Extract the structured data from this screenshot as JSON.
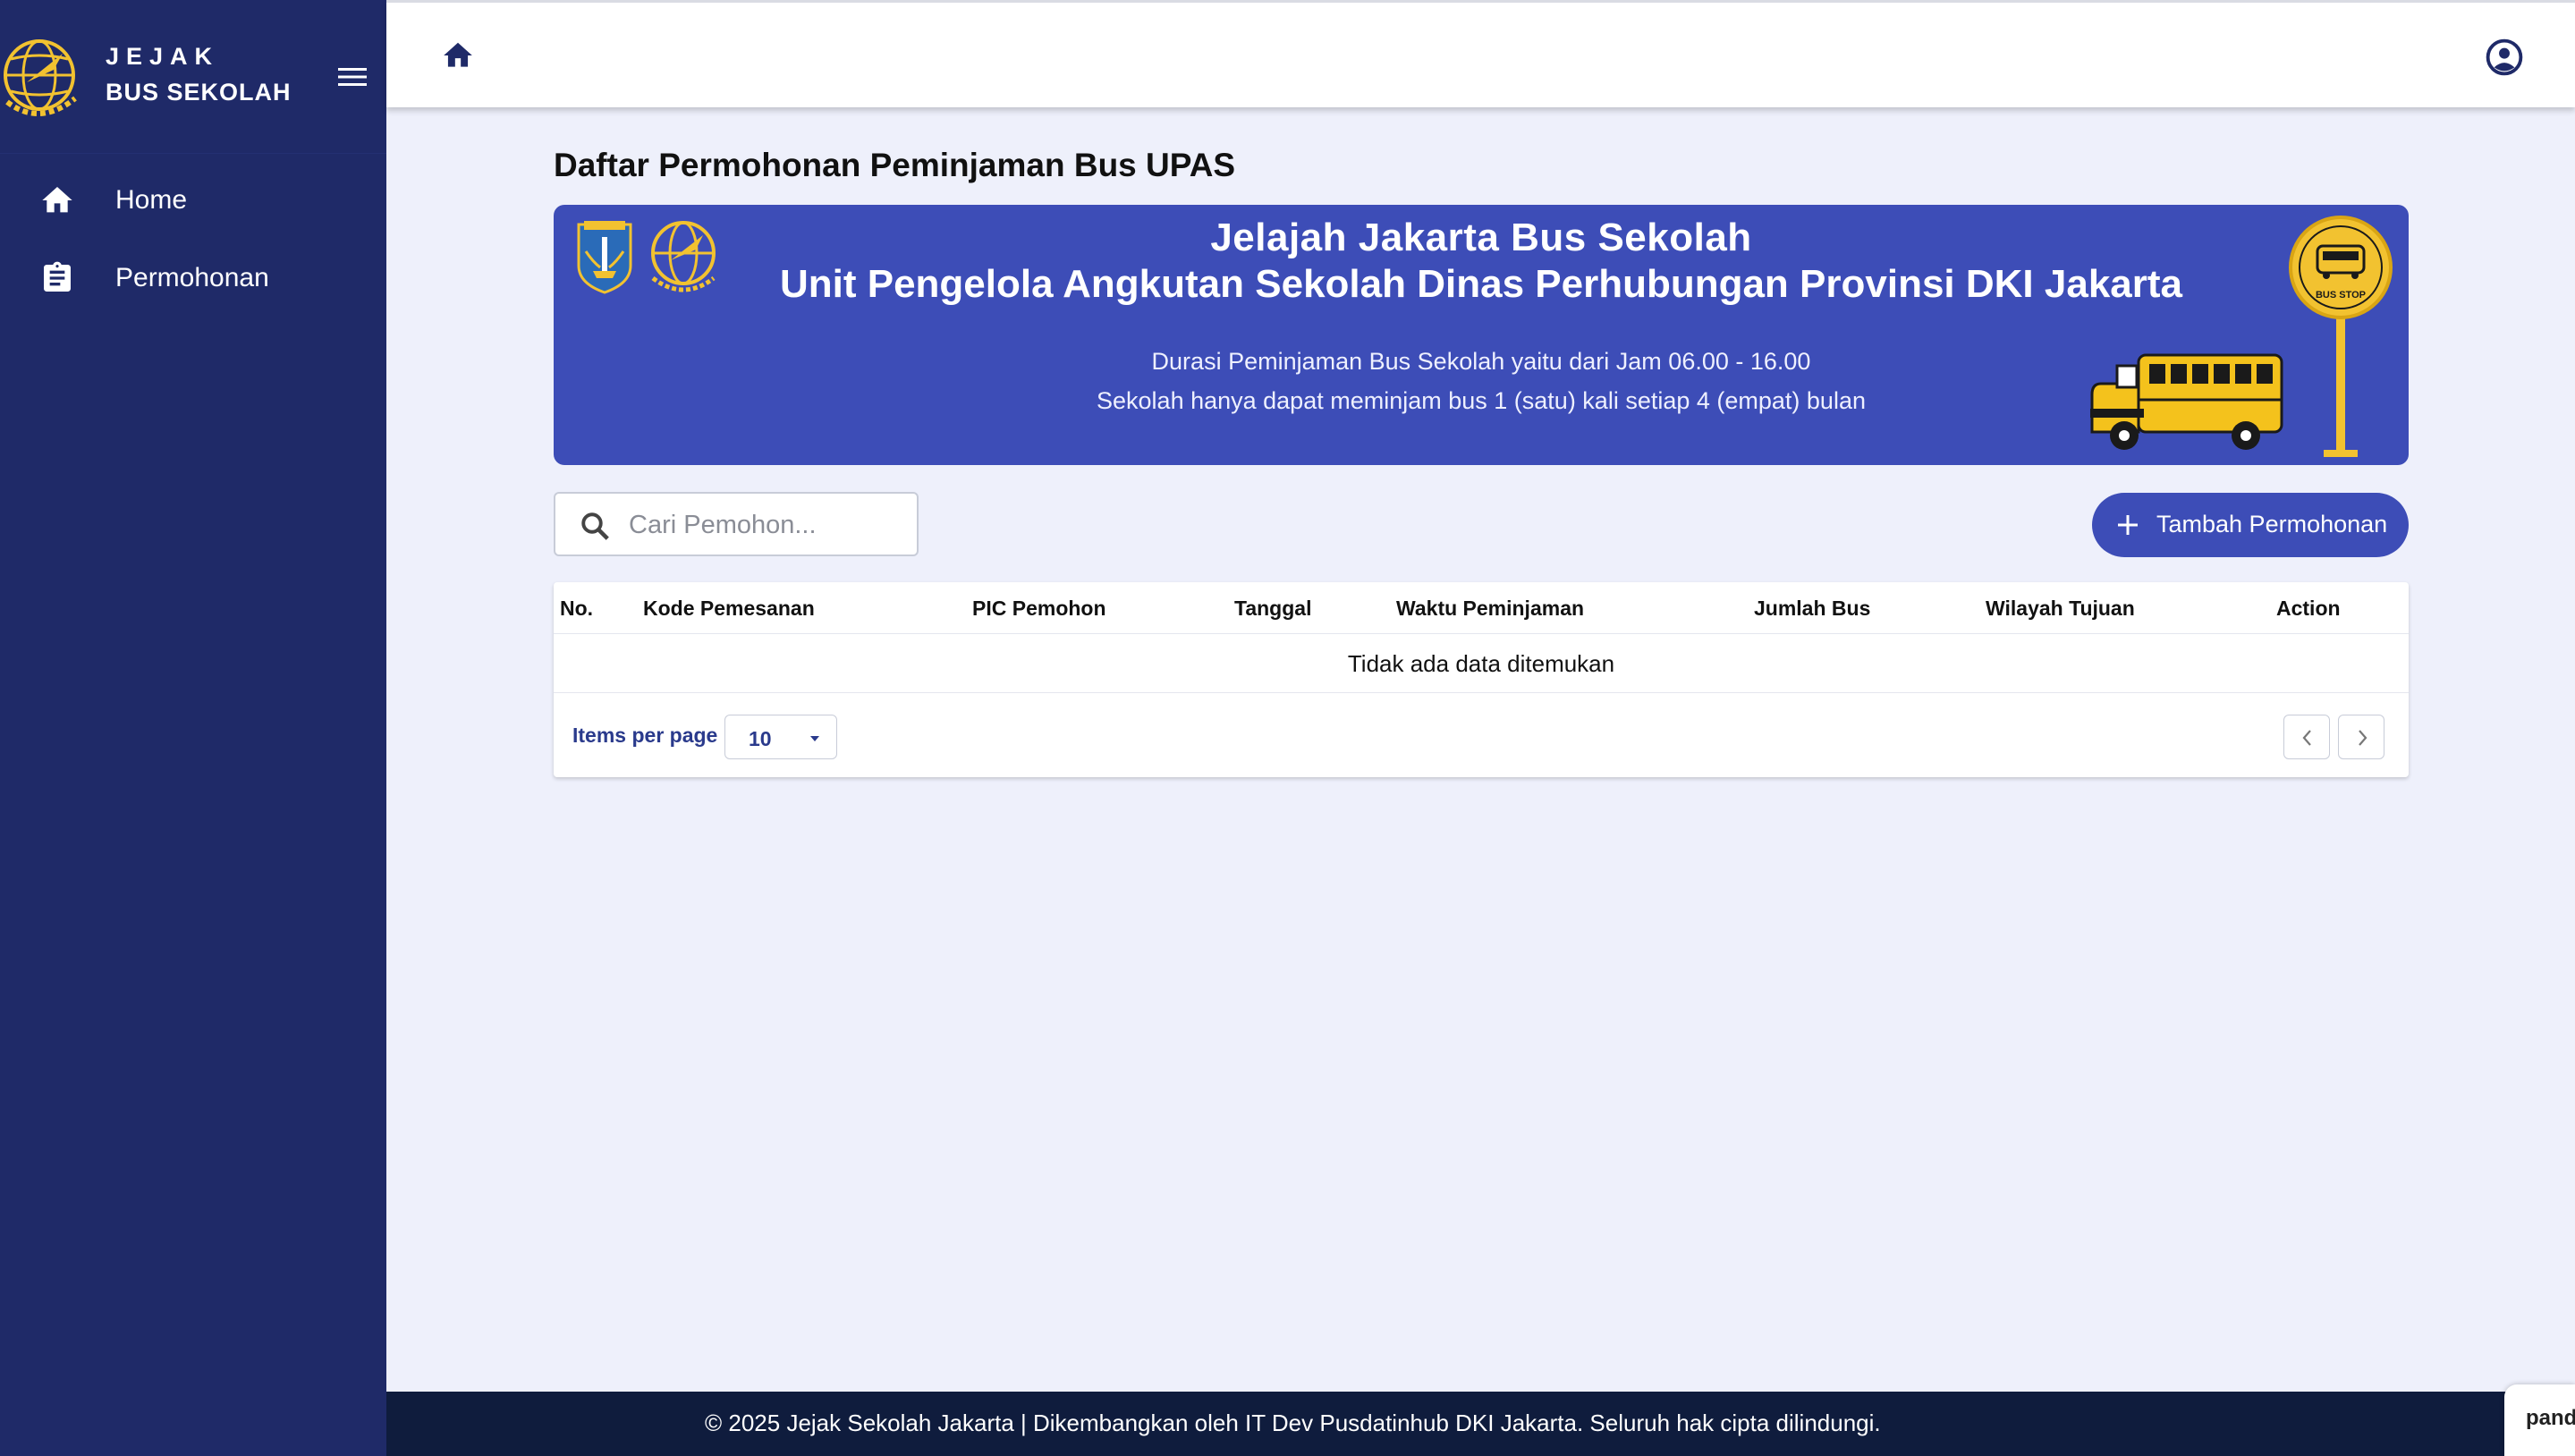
{
  "sidebar": {
    "brand_line1": "JEJAK",
    "brand_line2": "BUS SEKOLAH",
    "items": [
      {
        "label": "Home",
        "icon": "home-icon"
      },
      {
        "label": "Permohonan",
        "icon": "clipboard-icon"
      }
    ]
  },
  "topbar": {
    "home_icon": "home-icon",
    "user_icon": "account-circle-icon"
  },
  "page": {
    "title": "Daftar Permohonan Peminjaman Bus UPAS"
  },
  "banner": {
    "heading1": "Jelajah Jakarta Bus Sekolah",
    "heading2": "Unit Pengelola Angkutan Sekolah Dinas Perhubungan Provinsi DKI Jakarta",
    "line1": "Durasi Peminjaman Bus Sekolah yaitu dari Jam 06.00 - 16.00",
    "line2": "Sekolah hanya dapat meminjam bus 1 (satu) kali setiap 4 (empat) bulan",
    "busstop_text": "BUS STOP"
  },
  "search": {
    "placeholder": "Cari Pemohon...",
    "value": ""
  },
  "add_button": {
    "label": "Tambah Permohonan"
  },
  "table": {
    "columns": [
      "No.",
      "Kode Pemesanan",
      "PIC Pemohon",
      "Tanggal",
      "Waktu Peminjaman",
      "Jumlah Bus",
      "Wilayah Tujuan",
      "Action"
    ],
    "empty_text": "Tidak ada data ditemukan",
    "items_per_page_label": "Items per page",
    "items_per_page_value": "10"
  },
  "footer": {
    "text": "© 2025 Jejak Sekolah Jakarta | Dikembangkan oleh IT Dev Pusdatinhub DKI Jakarta. Seluruh hak cipta dilindungi."
  },
  "widget": {
    "text": "pand"
  },
  "colors": {
    "sidebar": "#1f2a68",
    "accent": "#3d4db7",
    "footer": "#0f1c3d",
    "background": "#eef0fb",
    "logo_gold": "#f2c230"
  }
}
